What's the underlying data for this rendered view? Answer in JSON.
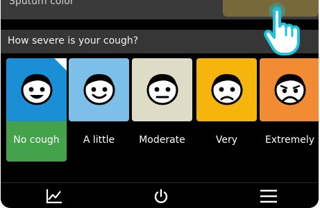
{
  "previous_question": {
    "label": "Sputum color",
    "swatch_color": "#77693a"
  },
  "question": {
    "text": "How severe is your cough?"
  },
  "options": [
    {
      "label": "No cough",
      "color": "#1a8fd6",
      "mood": "happy",
      "selected": true,
      "selected_color": "#43a24a"
    },
    {
      "label": "A little",
      "color": "#7cc0e9",
      "mood": "smile"
    },
    {
      "label": "Moderate",
      "color": "#dedcc7",
      "mood": "neutral"
    },
    {
      "label": "Very",
      "color": "#f5b50c",
      "mood": "sad"
    },
    {
      "label": "Extremely",
      "color": "#f28c34",
      "mood": "very-sad"
    }
  ],
  "nav": {
    "items": [
      "chart",
      "power",
      "menu"
    ]
  },
  "colors": {
    "background": "#000000",
    "question_bar": "#363636",
    "pointer": "#1fc3dc"
  }
}
